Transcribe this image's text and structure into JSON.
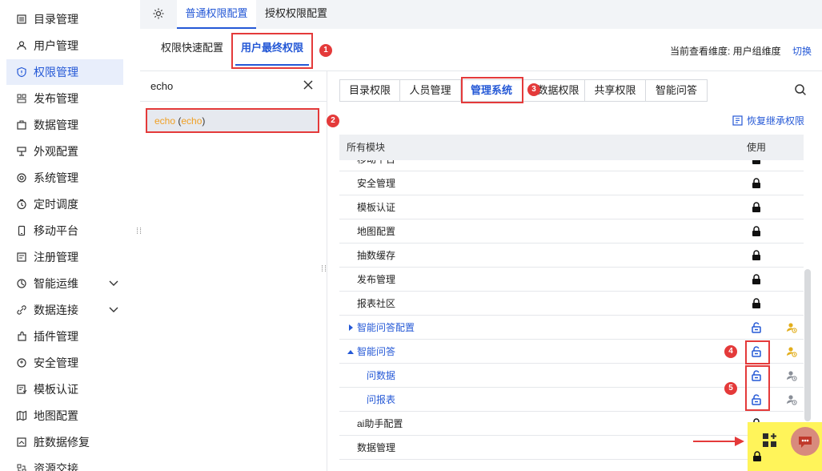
{
  "sidebar": {
    "items": [
      {
        "label": "目录管理",
        "icon": "list-icon",
        "active": false
      },
      {
        "label": "用户管理",
        "icon": "user-icon",
        "active": false
      },
      {
        "label": "权限管理",
        "icon": "shield-icon",
        "active": true
      },
      {
        "label": "发布管理",
        "icon": "publish-icon",
        "active": false
      },
      {
        "label": "数据管理",
        "icon": "database-icon",
        "active": false
      },
      {
        "label": "外观配置",
        "icon": "appearance-icon",
        "active": false
      },
      {
        "label": "系统管理",
        "icon": "gear-icon",
        "active": false
      },
      {
        "label": "定时调度",
        "icon": "clock-icon",
        "active": false
      },
      {
        "label": "移动平台",
        "icon": "mobile-icon",
        "active": false
      },
      {
        "label": "注册管理",
        "icon": "register-icon",
        "active": false
      },
      {
        "label": "智能运维",
        "icon": "ops-icon",
        "active": false,
        "expandable": true
      },
      {
        "label": "数据连接",
        "icon": "link-icon",
        "active": false,
        "expandable": true
      },
      {
        "label": "插件管理",
        "icon": "plugin-icon",
        "active": false
      },
      {
        "label": "安全管理",
        "icon": "security-icon",
        "active": false
      },
      {
        "label": "模板认证",
        "icon": "template-icon",
        "active": false
      },
      {
        "label": "地图配置",
        "icon": "map-icon",
        "active": false
      },
      {
        "label": "脏数据修复",
        "icon": "repair-icon",
        "active": false
      },
      {
        "label": "资源交接",
        "icon": "handover-icon",
        "active": false
      }
    ]
  },
  "top_tabs": [
    {
      "label": "普通权限配置",
      "active": true
    },
    {
      "label": "授权权限配置",
      "active": false
    }
  ],
  "sub_tabs": [
    {
      "label": "权限快速配置",
      "active": false
    },
    {
      "label": "用户最终权限",
      "active": true
    }
  ],
  "badges": [
    "1",
    "2",
    "3",
    "4",
    "5"
  ],
  "dimension": {
    "label": "当前查看维度: 用户组维度",
    "switch": "切换"
  },
  "user_search": {
    "value": "echo"
  },
  "user_list": [
    {
      "name": "echo",
      "id": "echo"
    }
  ],
  "module_tabs": [
    {
      "label": "目录权限",
      "active": false
    },
    {
      "label": "人员管理",
      "active": false
    },
    {
      "label": "管理系统",
      "active": true
    },
    {
      "label": "数据权限",
      "active": false
    },
    {
      "label": "共享权限",
      "active": false
    },
    {
      "label": "智能问答",
      "active": false
    }
  ],
  "restore_label": "恢复继承权限",
  "table": {
    "headers": {
      "module": "所有模块",
      "use": "使用"
    },
    "rows": [
      {
        "name": "移动平台",
        "lock": "locked",
        "link": false
      },
      {
        "name": "安全管理",
        "lock": "locked",
        "link": false
      },
      {
        "name": "模板认证",
        "lock": "locked",
        "link": false
      },
      {
        "name": "地图配置",
        "lock": "locked",
        "link": false
      },
      {
        "name": "抽数缓存",
        "lock": "locked",
        "link": false
      },
      {
        "name": "发布管理",
        "lock": "locked",
        "link": false
      },
      {
        "name": "报表社区",
        "lock": "locked",
        "link": false
      },
      {
        "name": "智能问答配置",
        "lock": "unlocked",
        "link": true,
        "caret": "right",
        "user_icon": "gold"
      },
      {
        "name": "智能问答",
        "lock": "unlocked",
        "link": true,
        "caret": "down",
        "user_icon": "gold"
      },
      {
        "name": "问数据",
        "lock": "unlocked",
        "link": true,
        "child": true,
        "user_icon": "gray"
      },
      {
        "name": "问报表",
        "lock": "unlocked",
        "link": true,
        "child": true,
        "user_icon": "gray"
      },
      {
        "name": "ai助手配置",
        "lock": "locked",
        "link": false
      },
      {
        "name": "数据管理",
        "lock": "locked",
        "link": false
      }
    ]
  },
  "colors": {
    "accent": "#2458d6",
    "highlight": "#e43a3a",
    "orange": "#f0a024",
    "gold": "#e2ae1c",
    "annotation_yellow": "#fff45a"
  }
}
